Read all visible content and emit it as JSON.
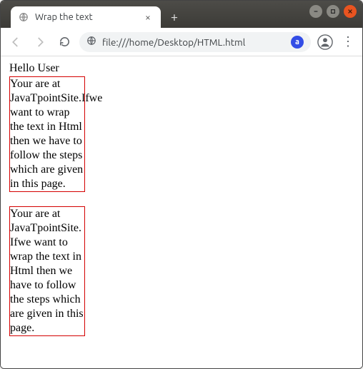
{
  "browser": {
    "tab_title": "Wrap the text",
    "url": "file:///home/Desktop/HTML.html",
    "extension_letter": "a"
  },
  "page": {
    "greeting": "Hello User",
    "box1_text": "Your are at JavaTpointSite.Ifwe want to wrap the text in Html then we have to follow the steps which are given in this page.",
    "box2_text": "Your are at JavaTpointSite.Ifwe want to wrap the text in Html then we have to follow the steps which are given in this page."
  }
}
